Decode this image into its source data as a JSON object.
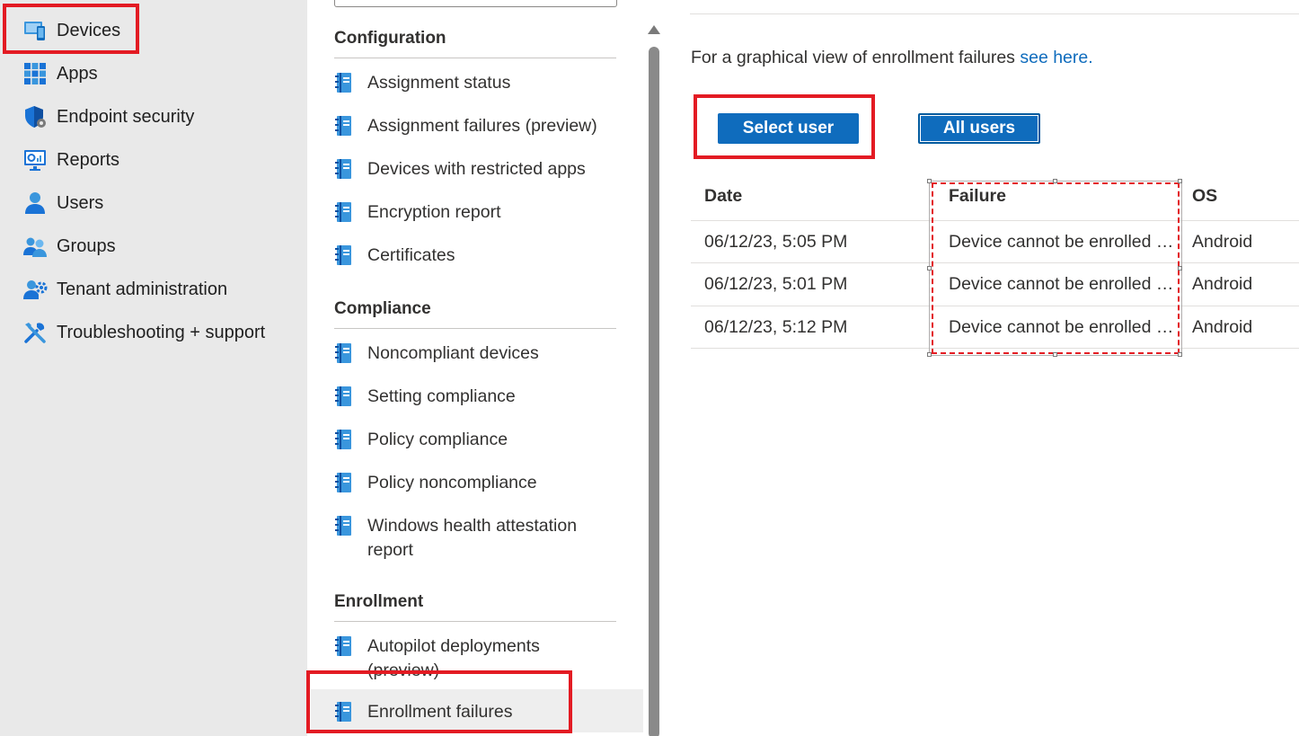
{
  "leftnav": {
    "items": [
      {
        "label": "Devices",
        "icon": "devices-icon"
      },
      {
        "label": "Apps",
        "icon": "apps-icon"
      },
      {
        "label": "Endpoint security",
        "icon": "endpoint-security-icon"
      },
      {
        "label": "Reports",
        "icon": "reports-icon"
      },
      {
        "label": "Users",
        "icon": "users-icon"
      },
      {
        "label": "Groups",
        "icon": "groups-icon"
      },
      {
        "label": "Tenant administration",
        "icon": "tenant-admin-icon"
      },
      {
        "label": "Troubleshooting + support",
        "icon": "troubleshooting-icon"
      }
    ]
  },
  "menu": {
    "sections": [
      {
        "title": "Configuration",
        "items": [
          "Assignment status",
          "Assignment failures (preview)",
          "Devices with restricted apps",
          "Encryption report",
          "Certificates"
        ]
      },
      {
        "title": "Compliance",
        "items": [
          "Noncompliant devices",
          "Setting compliance",
          "Policy compliance",
          "Policy noncompliance",
          "Windows health attestation report"
        ]
      },
      {
        "title": "Enrollment",
        "items": [
          "Autopilot deployments (preview)",
          "Enrollment failures"
        ]
      }
    ]
  },
  "main": {
    "info_text": "For a graphical view of enrollment failures ",
    "info_link": "see here.",
    "select_user_label": "Select user",
    "all_users_label": "All users",
    "table": {
      "headers": [
        "Date",
        "Failure",
        "OS"
      ],
      "rows": [
        [
          "06/12/23, 5:05 PM",
          "Device cannot be enrolled a...",
          "Android"
        ],
        [
          "06/12/23, 5:01 PM",
          "Device cannot be enrolled a...",
          "Android"
        ],
        [
          "06/12/23, 5:12 PM",
          "Device cannot be enrolled a...",
          "Android"
        ]
      ]
    }
  },
  "colors": {
    "accent": "#0f6cbd",
    "annotation": "#e31b23",
    "nav_bg": "#e9e9e9"
  }
}
